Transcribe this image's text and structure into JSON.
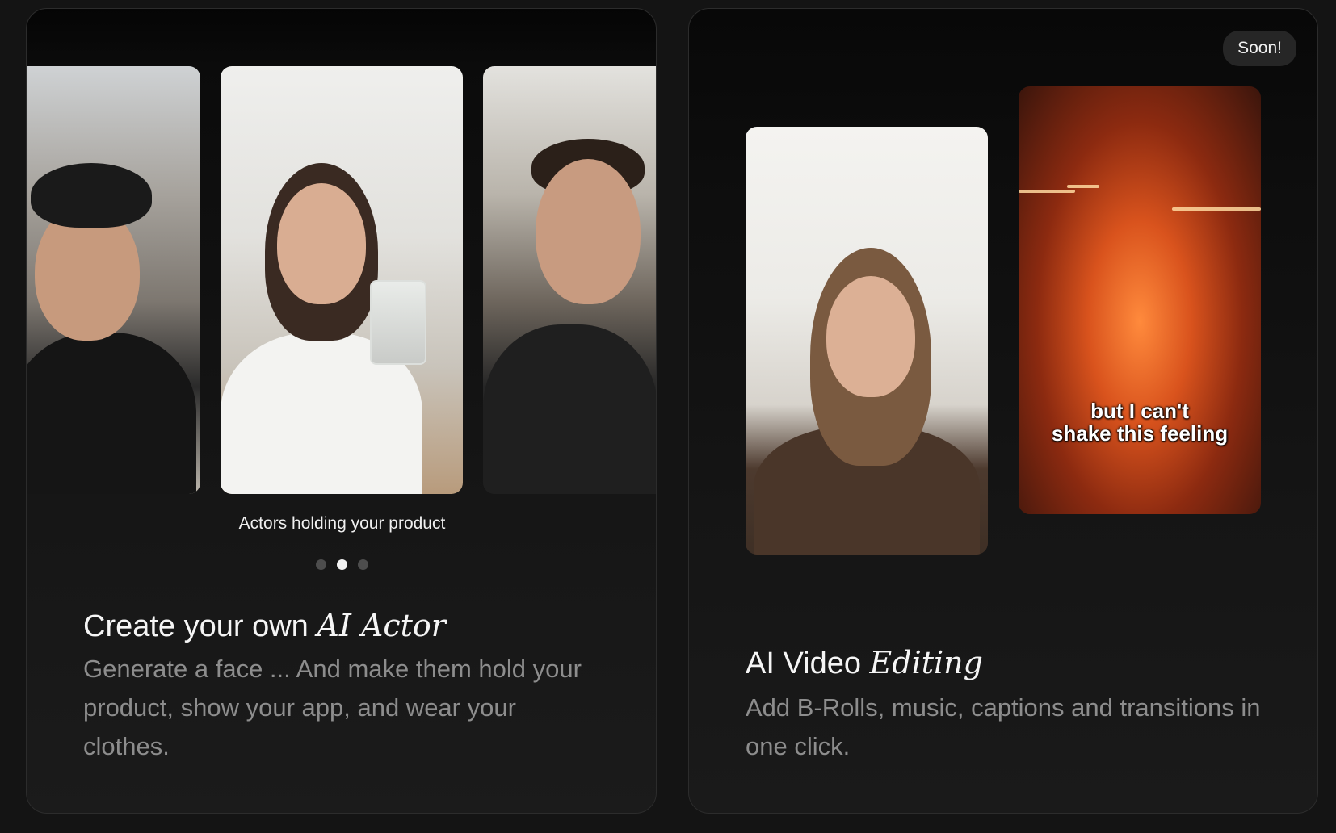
{
  "actor_card": {
    "carousel_caption": "Actors holding your product",
    "dots_count": 3,
    "active_dot": 1,
    "title_prefix": "Create your own ",
    "title_emphasis": "AI Actor",
    "description": "Generate a face ... And make them hold your product, show your app, and wear your clothes."
  },
  "editing_card": {
    "badge": "Soon!",
    "fire_caption_line1": "but I can't",
    "fire_caption_line2": "shake this feeling",
    "title_prefix": "AI Video ",
    "title_emphasis": "Editing",
    "description": "Add B-Rolls, music, captions and transitions in one click."
  }
}
